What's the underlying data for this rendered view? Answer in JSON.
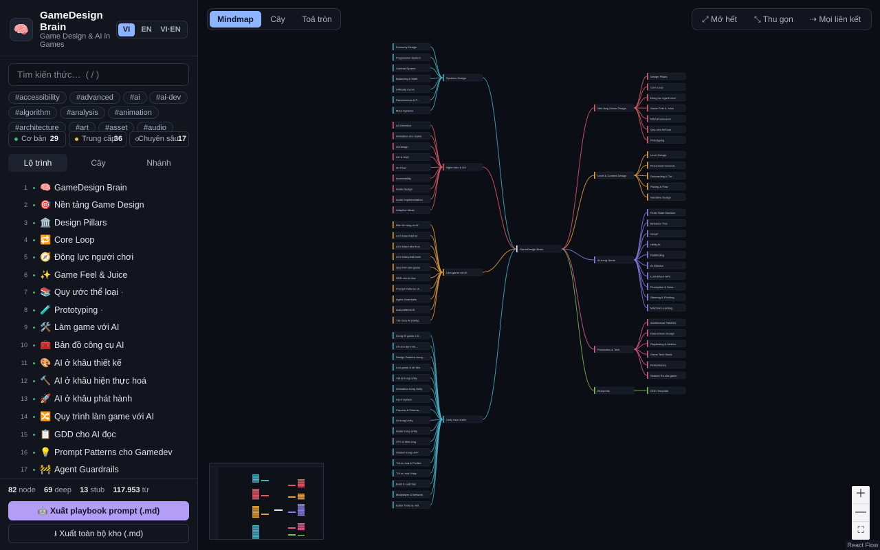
{
  "brand": {
    "title": "GameDesign Brain",
    "subtitle": "Game Design & AI in Games",
    "logo_icon": "brain-icon"
  },
  "lang": [
    "VI",
    "EN",
    "VI·EN"
  ],
  "search_placeholder": "Tìm kiến thức…  ( / )",
  "tags": [
    "#accessibility",
    "#advanced",
    "#ai",
    "#ai-dev",
    "#algorithm",
    "#analysis",
    "#animation",
    "#architecture",
    "#art",
    "#asset",
    "#audio"
  ],
  "levels": [
    {
      "label": "Cơ bản",
      "count": "29",
      "color": "#3fb97a"
    },
    {
      "label": "Trung cấp",
      "count": "36",
      "color": "#e8c44c"
    },
    {
      "label": "Chuyên sâu",
      "count": "17",
      "color": "#9aa1b1"
    }
  ],
  "view_tabs": [
    "Lộ trình",
    "Cây",
    "Nhánh"
  ],
  "toc": [
    {
      "n": "1",
      "icon": "🧠",
      "label": "GameDesign Brain",
      "extra": ""
    },
    {
      "n": "2",
      "icon": "🎯",
      "label": "Nền tảng Game Design",
      "extra": ""
    },
    {
      "n": "3",
      "icon": "🏛️",
      "label": "Design Pillars",
      "extra": ""
    },
    {
      "n": "4",
      "icon": "🔁",
      "label": "Core Loop",
      "extra": ""
    },
    {
      "n": "5",
      "icon": "🧭",
      "label": "Động lực người chơi",
      "extra": ""
    },
    {
      "n": "6",
      "icon": "✨",
      "label": "Game Feel & Juice",
      "extra": ""
    },
    {
      "n": "7",
      "icon": "📚",
      "label": "Quy ước thể loại",
      "extra": "·"
    },
    {
      "n": "8",
      "icon": "🧪",
      "label": "Prototyping",
      "extra": "·"
    },
    {
      "n": "9",
      "icon": "🛠️",
      "label": "Làm game với AI",
      "extra": ""
    },
    {
      "n": "10",
      "icon": "🧰",
      "label": "Bản đồ công cụ AI",
      "extra": ""
    },
    {
      "n": "11",
      "icon": "🎨",
      "label": "AI ở khâu thiết kế",
      "extra": ""
    },
    {
      "n": "12",
      "icon": "🔨",
      "label": "AI ở khâu hiện thực hoá",
      "extra": ""
    },
    {
      "n": "13",
      "icon": "🚀",
      "label": "AI ở khâu phát hành",
      "extra": ""
    },
    {
      "n": "14",
      "icon": "🔀",
      "label": "Quy trình làm game với AI",
      "extra": ""
    },
    {
      "n": "15",
      "icon": "📋",
      "label": "GDD cho AI đọc",
      "extra": ""
    },
    {
      "n": "16",
      "icon": "💡",
      "label": "Prompt Patterns cho Gamedev",
      "extra": ""
    },
    {
      "n": "17",
      "icon": "🚧",
      "label": "Agent Guardrails",
      "extra": ""
    }
  ],
  "stats": {
    "nodes": "82",
    "nodes_label": "node",
    "deep": "69",
    "deep_label": "deep",
    "stub": "13",
    "stub_label": "stub",
    "words": "117.953",
    "words_label": "từ"
  },
  "buttons": {
    "export_prompt": "🤖 Xuất playbook prompt (.md)",
    "export_all": "⭳  Xuất toàn bộ kho (.md)"
  },
  "view_modes": [
    "Mindmap",
    "Cây",
    "Toả tròn"
  ],
  "actions": [
    "⤢ Mở hết",
    "⤡ Thu gọn",
    "⇢ Mọi liên kết"
  ],
  "zoom_controls": [
    "＋",
    "—",
    "⛶"
  ],
  "attribution": "React Flow",
  "mindmap": {
    "root": "GameDesign Brain",
    "right": [
      {
        "label": "Nền tảng Game Design",
        "color": "#e05a6a",
        "children": [
          "Design Pillars",
          "Core Loop",
          "Động lực người chơi",
          "Game Feel & Juice",
          "MDA Framework",
          "Quy ước thể loại",
          "Prototyping"
        ]
      },
      {
        "label": "Level & Content Design",
        "color": "#e8a03c",
        "children": [
          "Level Design",
          "Procedural Generat…",
          "Onboarding & Tut…",
          "Pacing & Flow",
          "Narrative Design"
        ]
      },
      {
        "label": "AI trong Game",
        "color": "#8a7ee8",
        "children": [
          "Finite State Machine",
          "Behavior Tree",
          "GOAP",
          "Utility AI",
          "Pathfinding",
          "AI Director",
          "LLM-driven NPC",
          "Perception & Sens…",
          "Steering & Flocking",
          "Machine Learning…"
        ]
      },
      {
        "label": "Production & Tech",
        "color": "#e05a8a",
        "children": [
          "Architecture Patterns",
          "Data-Driven Design",
          "Playtesting & Metrics",
          "Game Tech Stack",
          "Performance",
          "Season Ra của game"
        ]
      },
      {
        "label": "Blueprints",
        "color": "#7cc24e",
        "children": [
          "GDD Template"
        ]
      }
    ],
    "left": [
      {
        "label": "Systems Design",
        "color": "#4ab0c8",
        "children": [
          "Economy Design",
          "Progression System",
          "Combat System",
          "Balancing & Math",
          "Difficulty Curve",
          "Randomness & P…",
          "Meta Systems"
        ]
      },
      {
        "label": "Nghe nhìn & UX",
        "color": "#e05a6a",
        "children": [
          "Art Direction",
          "Animation cho Game",
          "UI Design",
          "UX & HUD",
          "2D Pixel",
          "Accessibility",
          "Audio Design",
          "Audio Implementation",
          "Adaptive Music"
        ]
      },
      {
        "label": "Làm game với AI",
        "color": "#e8a03c",
        "children": [
          "Bản đồ công cụ AI",
          "AI ở khâu thiết kế",
          "AI ở khâu hiện thực",
          "AI ở khâu phát hành",
          "Quy trình làm game",
          "GDD cho AI đọc",
          "Prompt Patterns ch…",
          "Agent Guardrails",
          "Anti-patterns AI",
          "Tích hợp AI (Unity)"
        ]
      },
      {
        "label": "Unity thực chiến",
        "color": "#4ab0c8",
        "children": [
          "Dựng lõi game 2.5…",
          "C# cho lập trình…",
          "Design Patterns trong…",
          "Lưu game & dữ liệu",
          "Vật lý trong Unity",
          "Animation trong Unity",
          "Input System",
          "Camera & Cinema…",
          "UI trong Unity",
          "Audio trong Unity",
          "VFX & Hiệu ứng",
          "Shader trong URP",
          "Tối ưu hoá & Profiler",
          "Tối ưu hoá Unity",
          "Build & xuất bản",
          "Multiplayer & Network",
          "Editor Tools tự viết"
        ]
      }
    ]
  }
}
